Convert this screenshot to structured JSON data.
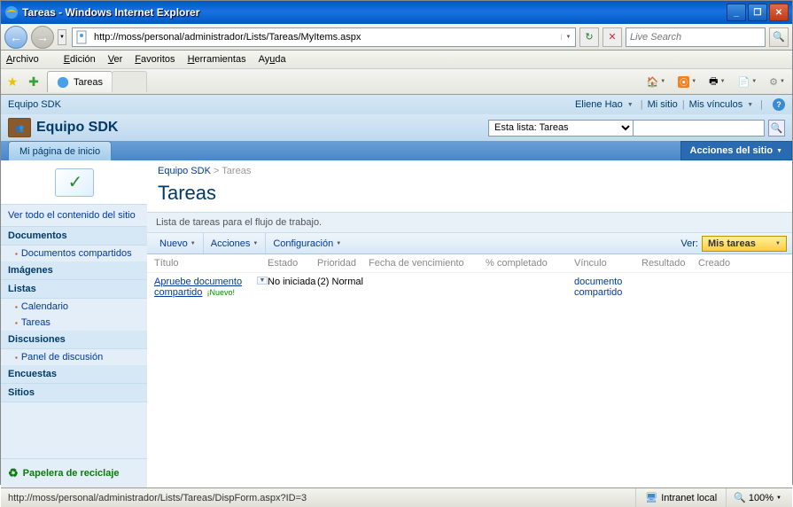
{
  "window": {
    "title": "Tareas - Windows Internet Explorer"
  },
  "nav": {
    "url": "http://moss/personal/administrador/Lists/Tareas/MyItems.aspx",
    "search_placeholder": "Live Search"
  },
  "menu": {
    "archivo": "Archivo",
    "edicion": "Edición",
    "ver": "Ver",
    "favoritos": "Favoritos",
    "herramientas": "Herramientas",
    "ayuda": "Ayuda"
  },
  "tab": {
    "title": "Tareas"
  },
  "sp_top": {
    "site": "Equipo SDK",
    "user": "Eliene Hao",
    "misitio": "Mi sitio",
    "vinculos": "Mis vínculos"
  },
  "header": {
    "title": "Equipo SDK",
    "scope": "Esta lista: Tareas",
    "tab": "Mi página de inicio",
    "actions": "Acciones del sitio"
  },
  "leftnav": {
    "viewall": "Ver todo el contenido del sitio",
    "docs_h": "Documentos",
    "docs1": "Documentos compartidos",
    "img_h": "Imágenes",
    "list_h": "Listas",
    "list1": "Calendario",
    "list2": "Tareas",
    "disc_h": "Discusiones",
    "disc1": "Panel de discusión",
    "enc_h": "Encuestas",
    "sit_h": "Sitios",
    "recycle": "Papelera de reciclaje"
  },
  "main": {
    "crumb_site": "Equipo SDK",
    "crumb_sep": ">",
    "crumb_list": "Tareas",
    "title": "Tareas",
    "desc": "Lista de tareas para el flujo de trabajo.",
    "tb_nuevo": "Nuevo",
    "tb_acc": "Acciones",
    "tb_conf": "Configuración",
    "view_label": "Ver:",
    "view_value": "Mis tareas",
    "cols": {
      "titulo": "Título",
      "estado": "Estado",
      "prioridad": "Prioridad",
      "fecha": "Fecha de vencimiento",
      "pct": "% completado",
      "vinculo": "Vínculo",
      "resultado": "Resultado",
      "creado": "Creado"
    },
    "row": {
      "titulo": "Apruebe documento compartido",
      "nuevo": "¡Nuevo!",
      "estado": "No iniciada",
      "prioridad": "(2) Normal",
      "vinculo": "documento compartido"
    }
  },
  "status": {
    "url": "http://moss/personal/administrador/Lists/Tareas/DispForm.aspx?ID=3",
    "zone": "Intranet local",
    "zoom": "100%"
  }
}
